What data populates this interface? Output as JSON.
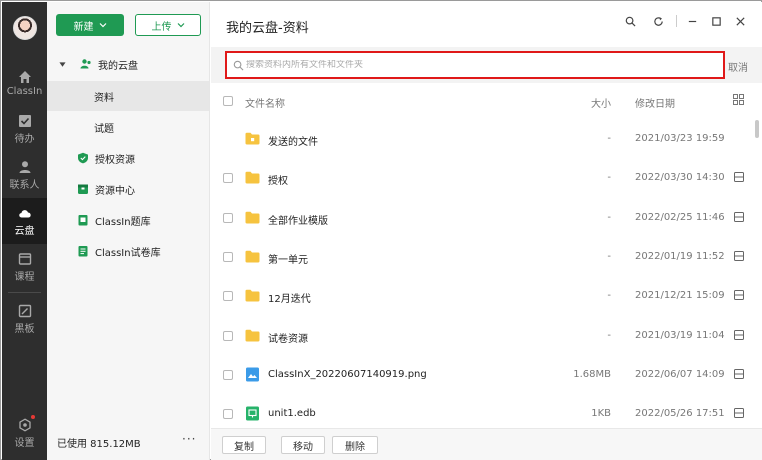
{
  "colors": {
    "accent": "#1f9a53",
    "highlight": "#e01919",
    "rail": "#2e2e2e"
  },
  "rail": {
    "items": [
      {
        "label": "ClassIn",
        "icon": "home-icon"
      },
      {
        "label": "待办",
        "icon": "todo-icon"
      },
      {
        "label": "联系人",
        "icon": "contacts-icon"
      },
      {
        "label": "云盘",
        "icon": "cloud-icon"
      },
      {
        "label": "课程",
        "icon": "course-icon"
      },
      {
        "label": "黑板",
        "icon": "blackboard-icon"
      },
      {
        "label": "设置",
        "icon": "settings-icon"
      }
    ]
  },
  "sidebar": {
    "new_label": "新建",
    "upload_label": "上传",
    "tree": [
      {
        "label": "我的云盘",
        "icon": "people-icon"
      },
      {
        "label": "资料",
        "icon": ""
      },
      {
        "label": "试题",
        "icon": ""
      },
      {
        "label": "授权资源",
        "icon": "shield-icon"
      },
      {
        "label": "资源中心",
        "icon": "box-icon"
      },
      {
        "label": "ClassIn题库",
        "icon": "question-bank-icon"
      },
      {
        "label": "ClassIn试卷库",
        "icon": "paper-bank-icon"
      }
    ],
    "usage": "已使用 815.12MB",
    "more": "···"
  },
  "main": {
    "title": "我的云盘-资料",
    "search_placeholder": "搜索资料内所有文件和文件夹",
    "cancel_label": "取消",
    "columns": {
      "name": "文件名称",
      "size": "大小",
      "date": "修改日期"
    },
    "files": [
      {
        "name": "发送的文件",
        "size": "-",
        "date": "2021/03/23 19:59",
        "type": "folder-special"
      },
      {
        "name": "授权",
        "size": "-",
        "date": "2022/03/30 14:30",
        "type": "folder"
      },
      {
        "name": "全部作业模版",
        "size": "-",
        "date": "2022/02/25 11:46",
        "type": "folder"
      },
      {
        "name": "第一单元",
        "size": "-",
        "date": "2022/01/19 11:52",
        "type": "folder"
      },
      {
        "name": "12月迭代",
        "size": "-",
        "date": "2021/12/21 15:09",
        "type": "folder"
      },
      {
        "name": "试卷资源",
        "size": "-",
        "date": "2021/03/19 11:04",
        "type": "folder"
      },
      {
        "name": "ClassInX_20220607140919.png",
        "size": "1.68MB",
        "date": "2022/06/07 14:09",
        "type": "image"
      },
      {
        "name": "unit1.edb",
        "size": "1KB",
        "date": "2022/05/26 17:51",
        "type": "edb"
      }
    ],
    "footer": {
      "copy_label": "复制",
      "move_label": "移动",
      "delete_label": "删除"
    }
  }
}
